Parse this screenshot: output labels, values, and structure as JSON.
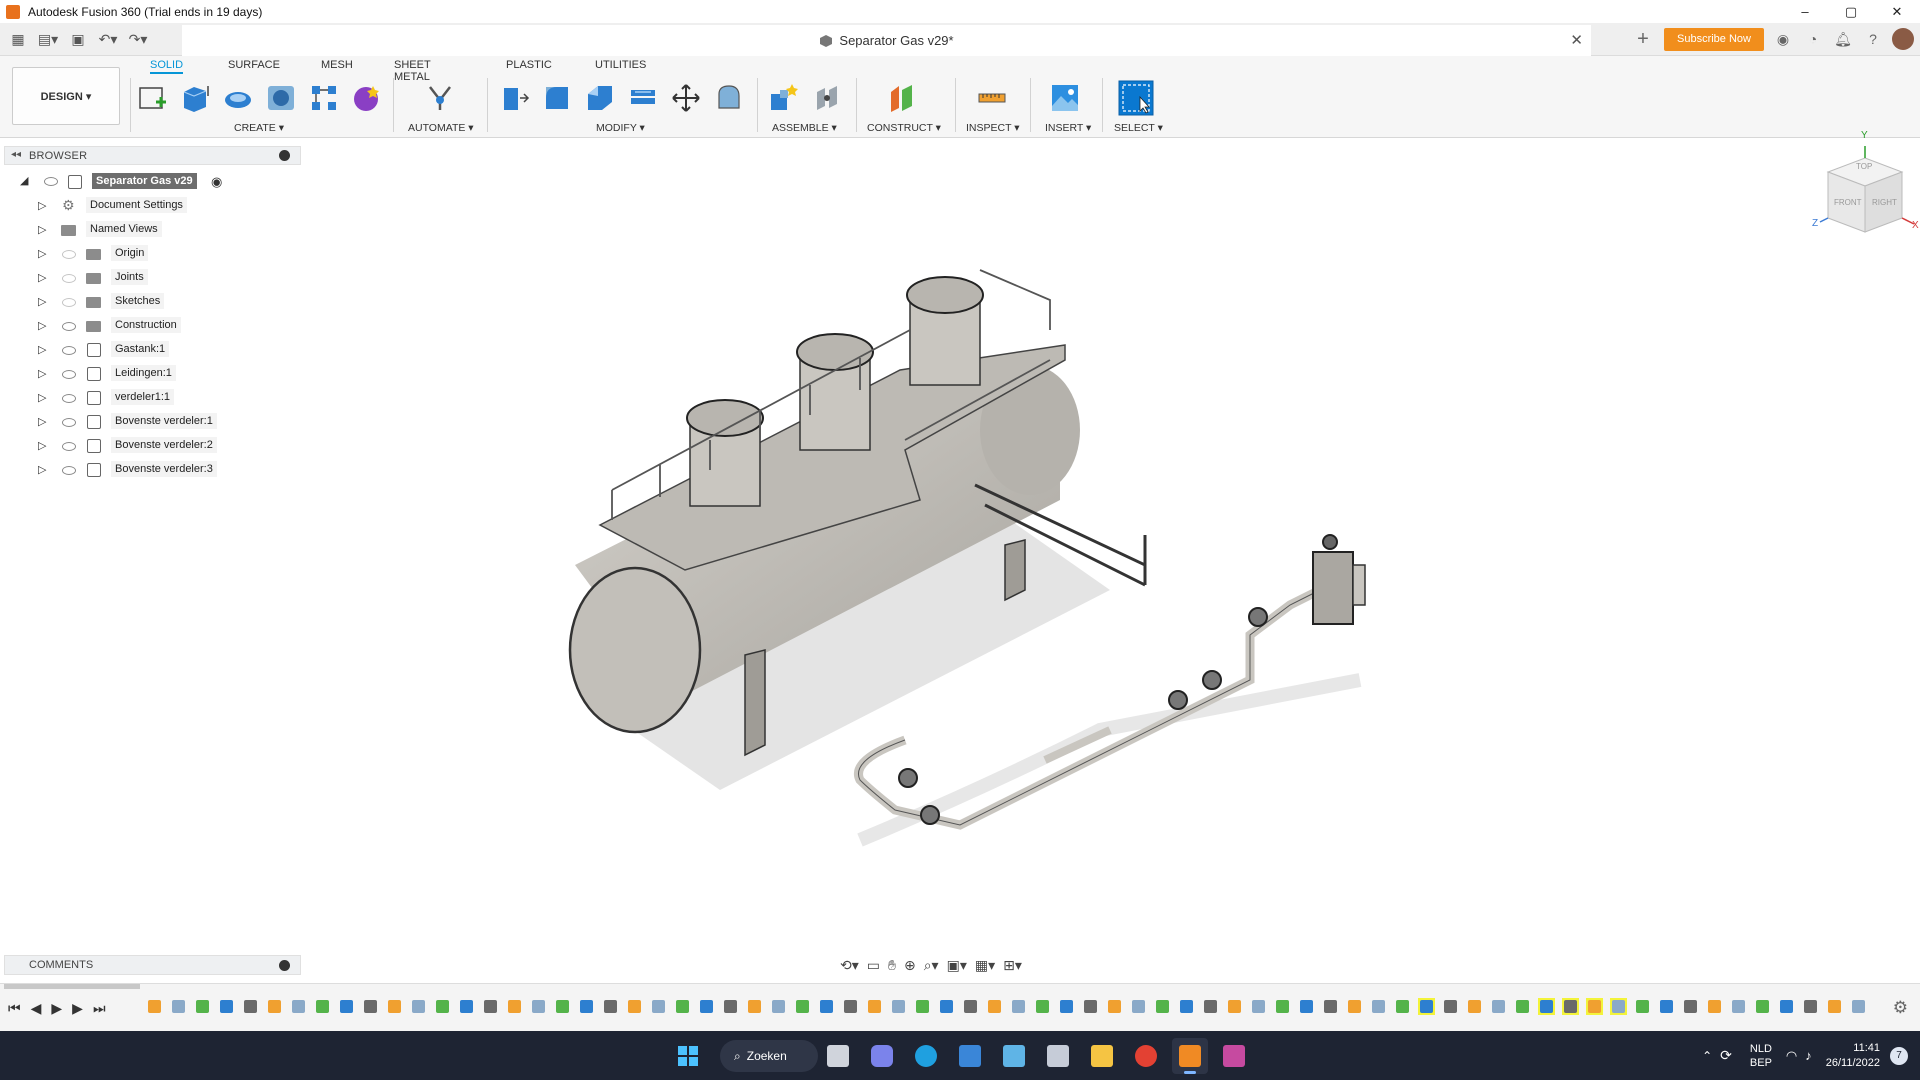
{
  "window": {
    "title": "Autodesk Fusion 360 (Trial ends in 19 days)",
    "controls": [
      "–",
      "▢",
      "✕"
    ]
  },
  "document": {
    "tab_title": "Separator Gas v29*",
    "close_glyph": "✕",
    "plus_glyph": "+",
    "subscribe_label": "Subscribe Now"
  },
  "workspace": {
    "design_label": "DESIGN ▾"
  },
  "ribbon": {
    "tabs": [
      "SOLID",
      "SURFACE",
      "MESH",
      "SHEET METAL",
      "PLASTIC",
      "UTILITIES"
    ],
    "active_tab": "SOLID",
    "groups": [
      "CREATE ▾",
      "AUTOMATE ▾",
      "MODIFY ▾",
      "ASSEMBLE ▾",
      "CONSTRUCT ▾",
      "INSPECT ▾",
      "INSERT ▾",
      "SELECT ▾"
    ]
  },
  "browser": {
    "title": "BROWSER",
    "root": "Separator Gas v29",
    "items": [
      {
        "label": "Document Settings",
        "type": "settings",
        "visible": null
      },
      {
        "label": "Named Views",
        "type": "folder",
        "visible": null
      },
      {
        "label": "Origin",
        "type": "folder",
        "visible": false
      },
      {
        "label": "Joints",
        "type": "folder",
        "visible": false
      },
      {
        "label": "Sketches",
        "type": "folder",
        "visible": false
      },
      {
        "label": "Construction",
        "type": "folder",
        "visible": true
      },
      {
        "label": "Gastank:1",
        "type": "component",
        "visible": true
      },
      {
        "label": "Leidingen:1",
        "type": "component",
        "visible": true
      },
      {
        "label": "verdeler1:1",
        "type": "component",
        "visible": true
      },
      {
        "label": "Bovenste verdeler:1",
        "type": "body",
        "visible": true
      },
      {
        "label": "Bovenste verdeler:2",
        "type": "body",
        "visible": true
      },
      {
        "label": "Bovenste verdeler:3",
        "type": "body",
        "visible": true
      }
    ]
  },
  "viewcube": {
    "top": "TOP",
    "front": "FRONT",
    "right": "RIGHT",
    "axis_x": "X",
    "axis_y": "Y",
    "axis_z": "Z"
  },
  "comments": {
    "title": "COMMENTS"
  },
  "taskbar": {
    "search_label": "Zoeken",
    "lang_line1": "NLD",
    "lang_line2": "BEP",
    "time": "11:41",
    "date": "26/11/2022",
    "notification_count": "7"
  },
  "colors": {
    "accent": "#0696d7",
    "subscribe": "#f18e1c",
    "model_body": "#c9c6c0",
    "taskbar": "#1e2433"
  }
}
